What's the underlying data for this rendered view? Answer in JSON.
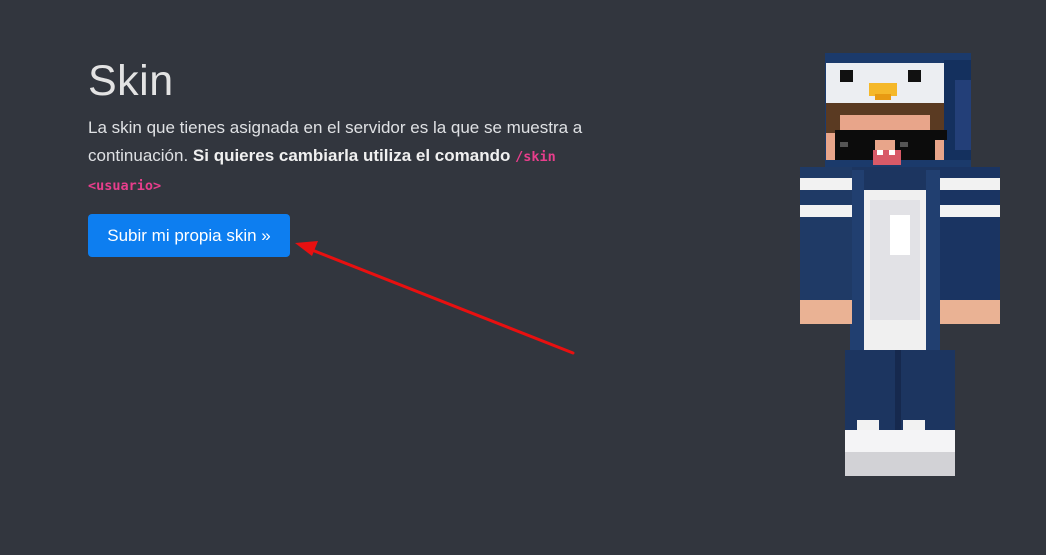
{
  "header": {
    "title": "Skin"
  },
  "description": {
    "text": "La skin que tienes asignada en el servidor es la que se muestra a continuación. ",
    "bold": "Si quieres cambiarla utiliza el comando",
    "command": "/skin <usuario>"
  },
  "actions": {
    "upload_label": "Subir mi propia skin »"
  },
  "annotation": {
    "arrow_color": "#e81010"
  },
  "colors": {
    "background": "#32363e",
    "button": "#0d7ef0",
    "command": "#e83e8c"
  },
  "skin_image": {
    "icon": "minecraft-skin-icon"
  }
}
